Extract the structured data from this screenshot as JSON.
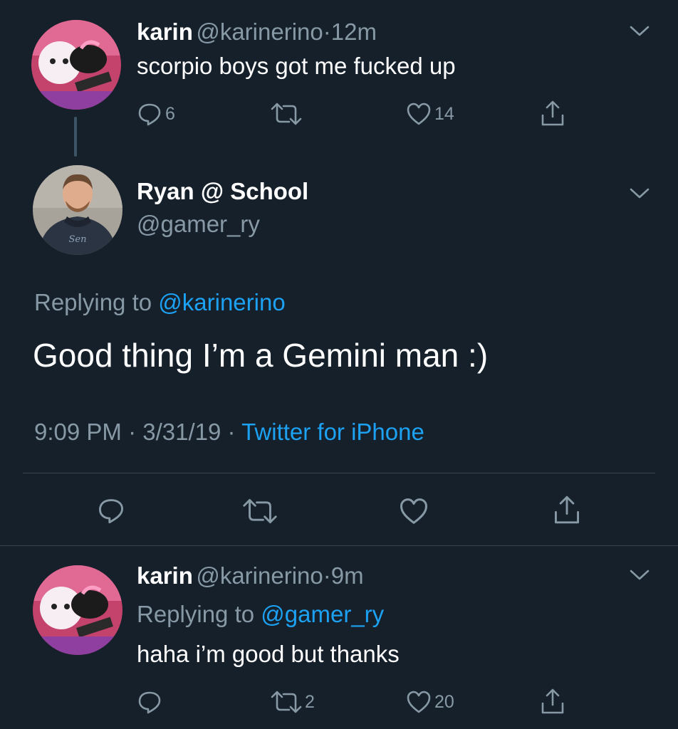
{
  "tweet1": {
    "name": "karin",
    "handle": "@karinerino",
    "dot": "·",
    "time": "12m",
    "text": "scorpio boys got me fucked up",
    "replies": "6",
    "retweets": "",
    "likes": "14"
  },
  "main_tweet": {
    "name": "Ryan @ School",
    "handle": "@gamer_ry",
    "replying_prefix": "Replying to",
    "replying_handle": "@karinerino",
    "text": "Good thing I’m a Gemini man :)",
    "timestamp": "9:09 PM · 3/31/19 ·",
    "source": "Twitter for iPhone"
  },
  "tweet3": {
    "name": "karin",
    "handle": "@karinerino",
    "dot": "·",
    "time": "9m",
    "replying_prefix": "Replying to",
    "replying_handle": "@gamer_ry",
    "text": "haha i’m good but thanks",
    "replies": "",
    "retweets": "2",
    "likes": "20"
  },
  "colors": {
    "background": "#15202b",
    "text": "#ffffff",
    "muted": "#8899a6",
    "accent": "#1da1f2",
    "divider": "#38444d"
  },
  "icons": [
    "reply-icon",
    "retweet-icon",
    "like-icon",
    "share-icon",
    "chevron-down-icon"
  ]
}
